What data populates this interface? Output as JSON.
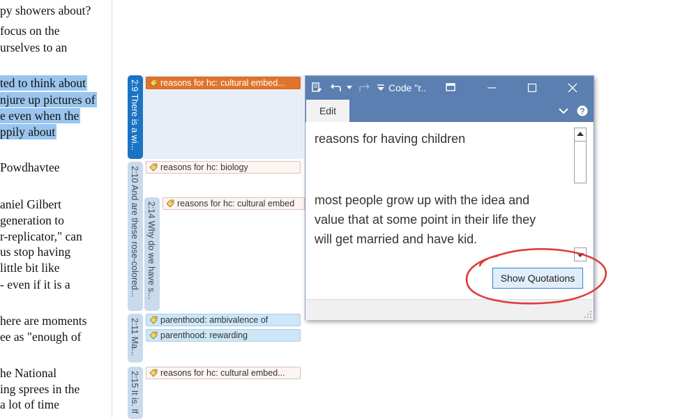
{
  "document": {
    "lines": [
      "py showers about?",
      "focus on the",
      "urselves to an",
      "",
      "ted to think about",
      "njure up pictures of",
      "e even when the",
      "ppily about",
      "",
      "Powdhavtee",
      "",
      "aniel Gilbert",
      "generation to",
      "r-replicator,\" can",
      "us stop having",
      "little bit like",
      "- even if it is a",
      "",
      "here are moments",
      "ee as \"enough of",
      "",
      "he National",
      "ing sprees in the",
      "a lot of time"
    ]
  },
  "quotations": [
    {
      "id": "2:9",
      "label": "2:9 There is a wi..."
    },
    {
      "id": "2:10",
      "label": "2:10 And are these rose-colored..."
    },
    {
      "id": "2:14",
      "label": "2:14 Why do we have s..."
    },
    {
      "id": "2:11",
      "label": "2:11 Ma..."
    },
    {
      "id": "2:15",
      "label": "2:15 It is. If"
    }
  ],
  "codes": [
    {
      "label": "reasons for hc: cultural embed..."
    },
    {
      "label": "reasons for hc: biology"
    },
    {
      "label": "reasons for hc: cultural embed"
    },
    {
      "label": "parenthood: ambivalence of"
    },
    {
      "label": "parenthood: rewarding"
    },
    {
      "label": "reasons for hc: cultural embed..."
    }
  ],
  "window": {
    "title": "Code \"r..",
    "tab_edit": "Edit",
    "code_name": "reasons for having children",
    "comment_lines": [
      "most people grow up with the idea and",
      "value that at some point in their life they",
      "will get married and have kid."
    ],
    "show_quotations_label": "Show Quotations"
  },
  "colors": {
    "title_bar": "#5a7fb0",
    "active_quotation": "#1b73c4",
    "orange_code": "#e0742a",
    "annotation_circle": "#e03a3a"
  }
}
